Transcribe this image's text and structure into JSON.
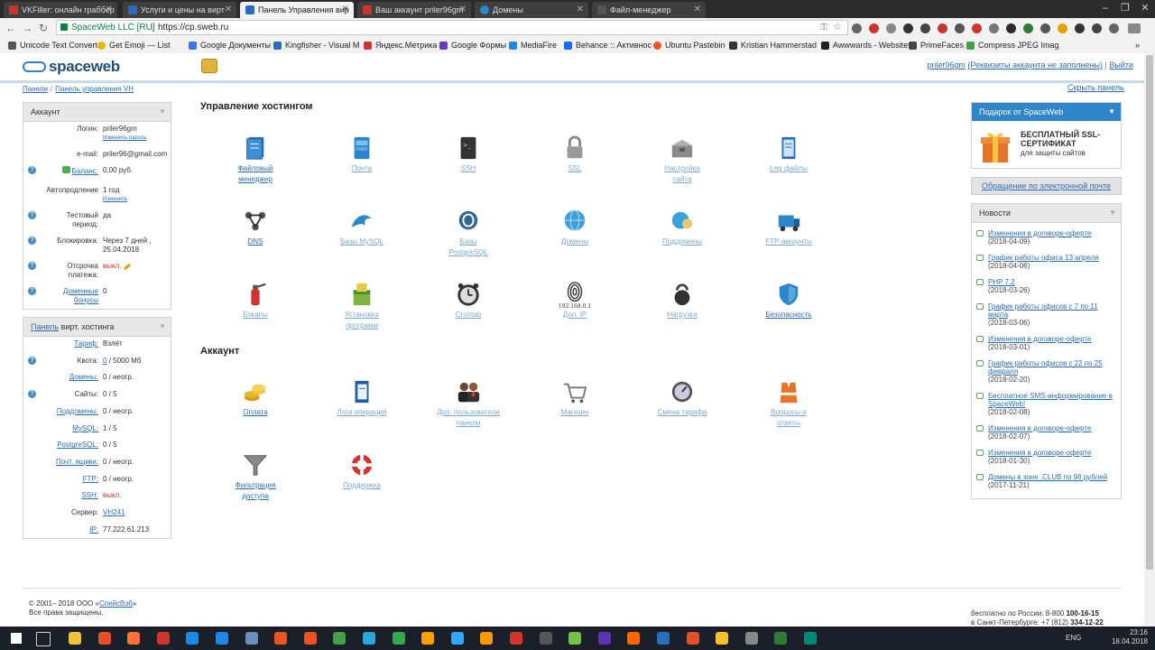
{
  "browser": {
    "tabs": [
      {
        "title": "VKFiller: онлайн граббер",
        "color": "#c0392b",
        "active": false
      },
      {
        "title": "Услуги и цены на вирт",
        "color": "#2a6ebb",
        "active": false
      },
      {
        "title": "Панель Управления вир",
        "color": "#2a6ebb",
        "active": true
      },
      {
        "title": "Ваш аккаунт priler96gm",
        "color": "#d0342c",
        "active": false
      },
      {
        "title": "Домены",
        "color": "#2e86c9",
        "active": false
      },
      {
        "title": "Файл-менеджер",
        "color": "#555",
        "active": false
      }
    ],
    "secure_label": "SpaceWeb LLC [RU]",
    "url": "https://cp.sweb.ru",
    "bookmarks": [
      {
        "label": "Unicode Text Convert",
        "color": "#555"
      },
      {
        "label": "Get Emoji — List",
        "color": "#e6b800"
      },
      {
        "label": "Google Документы",
        "color": "#3b78e7"
      },
      {
        "label": "Kingfisher - Visual M",
        "color": "#2a6ebb"
      },
      {
        "label": "Яндекс.Метрика",
        "color": "#d0342c"
      },
      {
        "label": "Google Формы",
        "color": "#673ab7"
      },
      {
        "label": "MediaFire",
        "color": "#1e88e5"
      },
      {
        "label": "Behance :: Активнос",
        "color": "#1769ff"
      },
      {
        "label": "Ubuntu Pastebin",
        "color": "#e95420"
      },
      {
        "label": "Kristian Hammerstad",
        "color": "#333"
      },
      {
        "label": "Awwwards - Website",
        "color": "#222"
      },
      {
        "label": "PrimeFaces",
        "color": "#444"
      },
      {
        "label": "Compress JPEG Imag",
        "color": "#43a047"
      }
    ]
  },
  "header": {
    "logo": "spaceweb",
    "user_link": "priler96gm",
    "user_note": "(Реквизиты аккаунта не заполнены)",
    "logout": "Выйти"
  },
  "breadcrumb": {
    "root": "Панели",
    "current": "Панель управления VH"
  },
  "hide_panel": "Скрыть панель",
  "account_panel": {
    "title": "Аккаунт",
    "login_label": "Логин:",
    "login_value": "priler96gm",
    "change_password": "Изменить пароль",
    "email_label": "e-mail:",
    "email_value": "priler96@gmail.com",
    "balance_label": "Баланс:",
    "balance_value": "0,00 руб.",
    "autorenew_label": "Автопродление",
    "autorenew_value": "1 год",
    "autorenew_change": "Изменить",
    "test_label_1": "Тестовый",
    "test_label_2": "период:",
    "test_value": "да",
    "block_label": "Блокировка:",
    "block_value_1": "Через 7 дней ,",
    "block_value_2": "25.04.2018",
    "defer_label_1": "Отсрочка",
    "defer_label_2": "платежа:",
    "defer_value": "выкл.",
    "bonus_label_1": "Доменные",
    "bonus_label_2": "бонусы",
    "bonus_value": "0"
  },
  "hosting_panel": {
    "title_link": "Панель",
    "title_rest": "вирт. хостинга",
    "rows": [
      {
        "label": "Тариф:",
        "value": "Взлёт",
        "link": true,
        "help": false,
        "value_link": false,
        "red": false
      },
      {
        "label": "Квота:",
        "value": "/ 5000 Мб",
        "prefix": "0",
        "link": false,
        "help": true,
        "value_link": true,
        "red": false
      },
      {
        "label": "Домены:",
        "value": "0 / неогр.",
        "link": true,
        "help": false,
        "value_link": false,
        "red": false
      },
      {
        "label": "Сайты:",
        "value": "0 / 5",
        "link": false,
        "help": true,
        "value_link": false,
        "red": false
      },
      {
        "label": "Поддомены:",
        "value": "0 / неогр.",
        "link": true,
        "help": false,
        "value_link": false,
        "red": false
      },
      {
        "label": "MySQL:",
        "value": "1 / 5",
        "link": true,
        "help": false,
        "value_link": false,
        "red": false
      },
      {
        "label": "PostgreSQL:",
        "value": "0 / 5",
        "link": true,
        "help": false,
        "value_link": false,
        "red": false
      },
      {
        "label": "Почт. ящики:",
        "value": "0 / неогр.",
        "link": true,
        "help": false,
        "value_link": false,
        "red": false
      },
      {
        "label": "FTP:",
        "value": "0 / неогр.",
        "link": true,
        "help": false,
        "value_link": false,
        "red": false
      },
      {
        "label": "SSH:",
        "value": "выкл.",
        "link": true,
        "help": false,
        "value_link": false,
        "red": true
      },
      {
        "label": "Сервер:",
        "value": "VH241",
        "link": false,
        "help": false,
        "value_link": true,
        "red": false
      },
      {
        "label": "IP:",
        "value": "77.222.61.213",
        "link": true,
        "help": false,
        "value_link": false,
        "red": false
      }
    ]
  },
  "hosting_section": {
    "title": "Управление хостингом",
    "tiles": [
      {
        "name": "file-manager",
        "l1": "Файловый",
        "l2": "менеджер",
        "icon": "file-manager-icon",
        "dim": false
      },
      {
        "name": "mail",
        "l1": "Почта",
        "l2": "",
        "icon": "mail-icon",
        "dim": true
      },
      {
        "name": "ssh",
        "l1": "SSH",
        "l2": "",
        "icon": "terminal-icon",
        "dim": true
      },
      {
        "name": "ssl",
        "l1": "SSL",
        "l2": "",
        "icon": "padlock-icon",
        "dim": true
      },
      {
        "name": "site-settings",
        "l1": "Настройка",
        "l2": "сайта",
        "icon": "toolbox-icon",
        "dim": true
      },
      {
        "name": "log-files",
        "l1": "Log файлы",
        "l2": "",
        "icon": "log-book-icon",
        "dim": true
      },
      {
        "name": "dns",
        "l1": "DNS",
        "l2": "",
        "icon": "dns-network-icon",
        "dim": false
      },
      {
        "name": "mysql",
        "l1": "Базы MySQL",
        "l2": "",
        "icon": "dolphin-icon",
        "dim": true
      },
      {
        "name": "postgresql",
        "l1": "Базы",
        "l2": "PostgreSQL",
        "icon": "elephant-icon",
        "dim": true
      },
      {
        "name": "domains",
        "l1": "Домены",
        "l2": "",
        "icon": "globe-icon",
        "dim": true
      },
      {
        "name": "subdomains",
        "l1": "Поддомены",
        "l2": "",
        "icon": "globe-small-icon",
        "dim": true
      },
      {
        "name": "ftp-accounts",
        "l1": "FTP-аккаунты",
        "l2": "",
        "icon": "ftp-truck-icon",
        "dim": true
      },
      {
        "name": "backups",
        "l1": "Бэкапы",
        "l2": "",
        "icon": "fire-extinguisher-icon",
        "dim": true
      },
      {
        "name": "app-install",
        "l1": "Установка",
        "l2": "программ",
        "icon": "install-box-icon",
        "dim": true
      },
      {
        "name": "crontab",
        "l1": "Crontab",
        "l2": "",
        "icon": "alarm-clock-icon",
        "dim": true
      },
      {
        "name": "extra-ip",
        "l1": "Доп. IP",
        "l2": "",
        "icon": "fingerprint-icon",
        "dim": true,
        "ip_caption": "192.168.0.1"
      },
      {
        "name": "load",
        "l1": "Нагрузка",
        "l2": "",
        "icon": "kettlebell-icon",
        "dim": true
      },
      {
        "name": "security",
        "l1": "Безопасность",
        "l2": "",
        "icon": "shield-icon",
        "dim": false
      }
    ]
  },
  "account_section": {
    "title": "Аккаунт",
    "tiles": [
      {
        "name": "payment",
        "l1": "Оплата",
        "l2": "",
        "icon": "coins-icon",
        "dim": false
      },
      {
        "name": "operation-logs",
        "l1": "Логи операций",
        "l2": "",
        "icon": "logbook-icon",
        "dim": true
      },
      {
        "name": "extra-users",
        "l1": "Доп. пользователи",
        "l2": "панели",
        "icon": "users-icon",
        "dim": true
      },
      {
        "name": "shop",
        "l1": "Магазин",
        "l2": "",
        "icon": "cart-icon",
        "dim": true
      },
      {
        "name": "change-tariff",
        "l1": "Смена тарифа",
        "l2": "",
        "icon": "dial-icon",
        "dim": true
      },
      {
        "name": "faq",
        "l1": "Вопросы и",
        "l2": "ответы",
        "icon": "lifejacket-icon",
        "dim": true
      },
      {
        "name": "access-filter",
        "l1": "Фильтрация",
        "l2": "доступа",
        "icon": "funnel-icon",
        "dim": false
      },
      {
        "name": "support",
        "l1": "Поддержка",
        "l2": "",
        "icon": "lifebuoy-icon",
        "dim": true
      }
    ]
  },
  "gift": {
    "title": "Подарок от SpaceWeb",
    "line1": "БЕСПЛАТНЫЙ SSL-",
    "line2": "СЕРТИФИКАТ",
    "line3": "для защиты сайтов"
  },
  "email_contact": "Обращение по электронной почте",
  "news": {
    "title": "Новости",
    "items": [
      {
        "title": "Изменения в договоре-оферте",
        "date": "(2018-04-09)"
      },
      {
        "title": "График работы офиса 13 апреля",
        "date": "(2018-04-06)"
      },
      {
        "title": "PHP 7.2",
        "date": "(2018-03-26)"
      },
      {
        "title": "График работы офисов с 7 по 11 марта",
        "date": "(2018-03-06)"
      },
      {
        "title": "Изменения в договоре-оферте",
        "date": "(2018-03-01)"
      },
      {
        "title": "График работы офисов с 22 по 25 февраля",
        "date": "(2018-02-20)"
      },
      {
        "title": "Бесплатное SMS-информирование в SpaceWeb!",
        "date": "(2018-02-08)"
      },
      {
        "title": "Изменения в договоре-оферте",
        "date": "(2018-02-07)"
      },
      {
        "title": "Изменения в договоре-оферте",
        "date": "(2018-01-30)"
      },
      {
        "title": "Домены в зоне .CLUB по 98 рублей",
        "date": "(2017-11-21)"
      }
    ]
  },
  "footer": {
    "copy_prefix": "© 2001– 2018 ООО «",
    "copy_link": "СпейсВэб",
    "copy_suffix": "»",
    "rights": "Все права защищены.",
    "phone_ru_label": "бесплатно по России: 8-800",
    "phone_ru_num": "100-16-15",
    "phone_spb_label": "в Санкт-Петербурге: +7 (812)",
    "phone_spb_num": "334-12-22"
  },
  "taskbar": {
    "lang": "ENG",
    "time": "23:16",
    "date": "18.04.2018",
    "apps": [
      "#f0c040",
      "#e34f26",
      "#ff7139",
      "#d0342c",
      "#1e88e5",
      "#1e88e5",
      "#6c8ebf",
      "#e95420",
      "#f25022",
      "#43a047",
      "#2ca5e0",
      "#34a853",
      "#ffa000",
      "#31a8ff",
      "#ff9800",
      "#d0342c",
      "#555",
      "#76c043",
      "#5e35b1",
      "#ff6a00",
      "#2a6ebb",
      "#e34f26",
      "#fbc02d",
      "#888",
      "#2e7d32",
      "#00897b"
    ]
  }
}
